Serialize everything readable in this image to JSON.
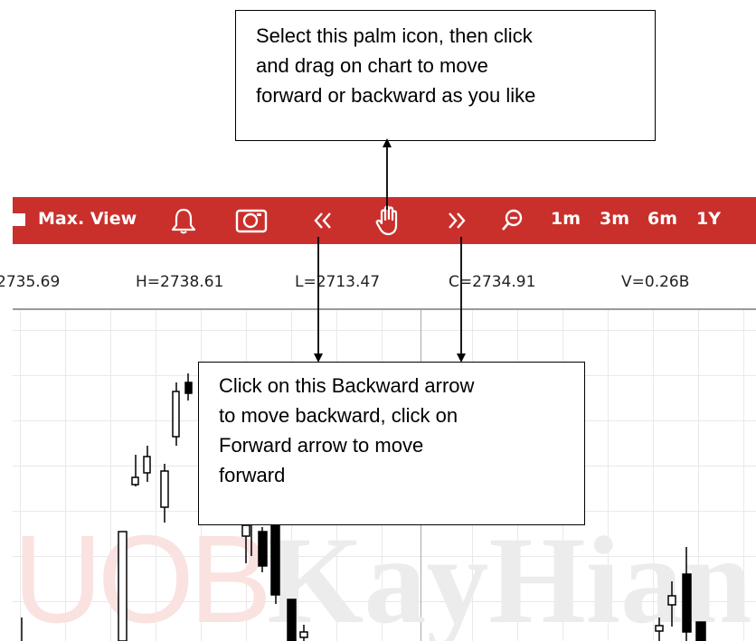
{
  "toolbar": {
    "max_view_label": "Max. View",
    "range_buttons": [
      "1m",
      "3m",
      "6m",
      "1Y"
    ],
    "icons": [
      "checkbox-icon",
      "bell-icon",
      "camera-icon",
      "double-chevron-left-icon",
      "palm-hand-icon",
      "double-chevron-right-icon",
      "zoom-out-icon"
    ],
    "color": "#c9302c"
  },
  "ohlc": {
    "open": "2735.69",
    "high": "H=2738.61",
    "low": "L=2713.47",
    "close": "C=2734.91",
    "volume": "V=0.26B"
  },
  "watermark": {
    "part1": "UOB",
    "part2": "KayHian"
  },
  "callouts": {
    "palm": {
      "line1": "Select this palm icon, then click",
      "line2": "and drag on chart to move",
      "line3": "forward or backward as you like"
    },
    "arrows": {
      "line1": "Click on this Backward arrow",
      "line2": "to move backward, click on",
      "line3": "Forward arrow to move",
      "line4": "forward"
    }
  }
}
